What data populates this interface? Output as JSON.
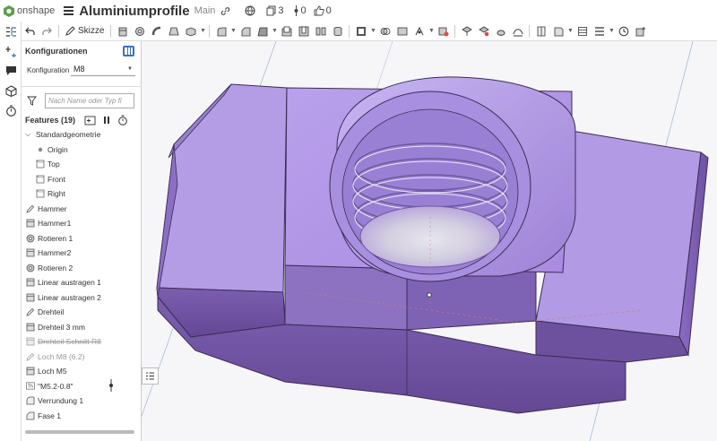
{
  "app": {
    "logo_text": "onshape"
  },
  "document": {
    "title": "Aluminiumprofile",
    "branch": "Main",
    "versions_count": "3",
    "branches_count": "0",
    "likes_count": "0"
  },
  "toolbar": {
    "sketch_label": "Skizze"
  },
  "panel": {
    "config_heading": "Konfigurationen",
    "config_label": "Konfiguration",
    "config_value": "M8",
    "search_placeholder": "Nach Name oder Typ fi",
    "features_heading": "Features (19)"
  },
  "tree": {
    "group": "Standardgeometrie",
    "defaults": [
      "Origin",
      "Top",
      "Front",
      "Right"
    ],
    "features": [
      {
        "label": "Hammer",
        "icon": "sketch-icon"
      },
      {
        "label": "Hammer1",
        "icon": "extrude-icon"
      },
      {
        "label": "Rotieren 1",
        "icon": "revolve-icon"
      },
      {
        "label": "Hammer2",
        "icon": "extrude-icon"
      },
      {
        "label": "Rotieren 2",
        "icon": "revolve-icon"
      },
      {
        "label": "Linear austragen 1",
        "icon": "extrude-icon"
      },
      {
        "label": "Linear austragen 2",
        "icon": "extrude-icon"
      },
      {
        "label": "Drehteil",
        "icon": "sketch-icon"
      },
      {
        "label": "Drehteil 3 mm",
        "icon": "extrude-icon"
      },
      {
        "label": "Drehteil Schnitt R8",
        "icon": "extrude-icon",
        "state": "suppressed"
      },
      {
        "label": "Loch M8 (6.2)",
        "icon": "sketch-icon",
        "state": "dimmed"
      },
      {
        "label": "Loch M5",
        "icon": "extrude-icon"
      },
      {
        "label": "\"M5.2-0.8\"",
        "icon": "text-icon"
      },
      {
        "label": "Verrundung 1",
        "icon": "fillet-icon"
      },
      {
        "label": "Fase 1",
        "icon": "chamfer-icon"
      }
    ]
  },
  "colors": {
    "part_fill": "#b49ae6",
    "part_dark": "#6e4f9e",
    "accent": "#3d6fb8"
  }
}
